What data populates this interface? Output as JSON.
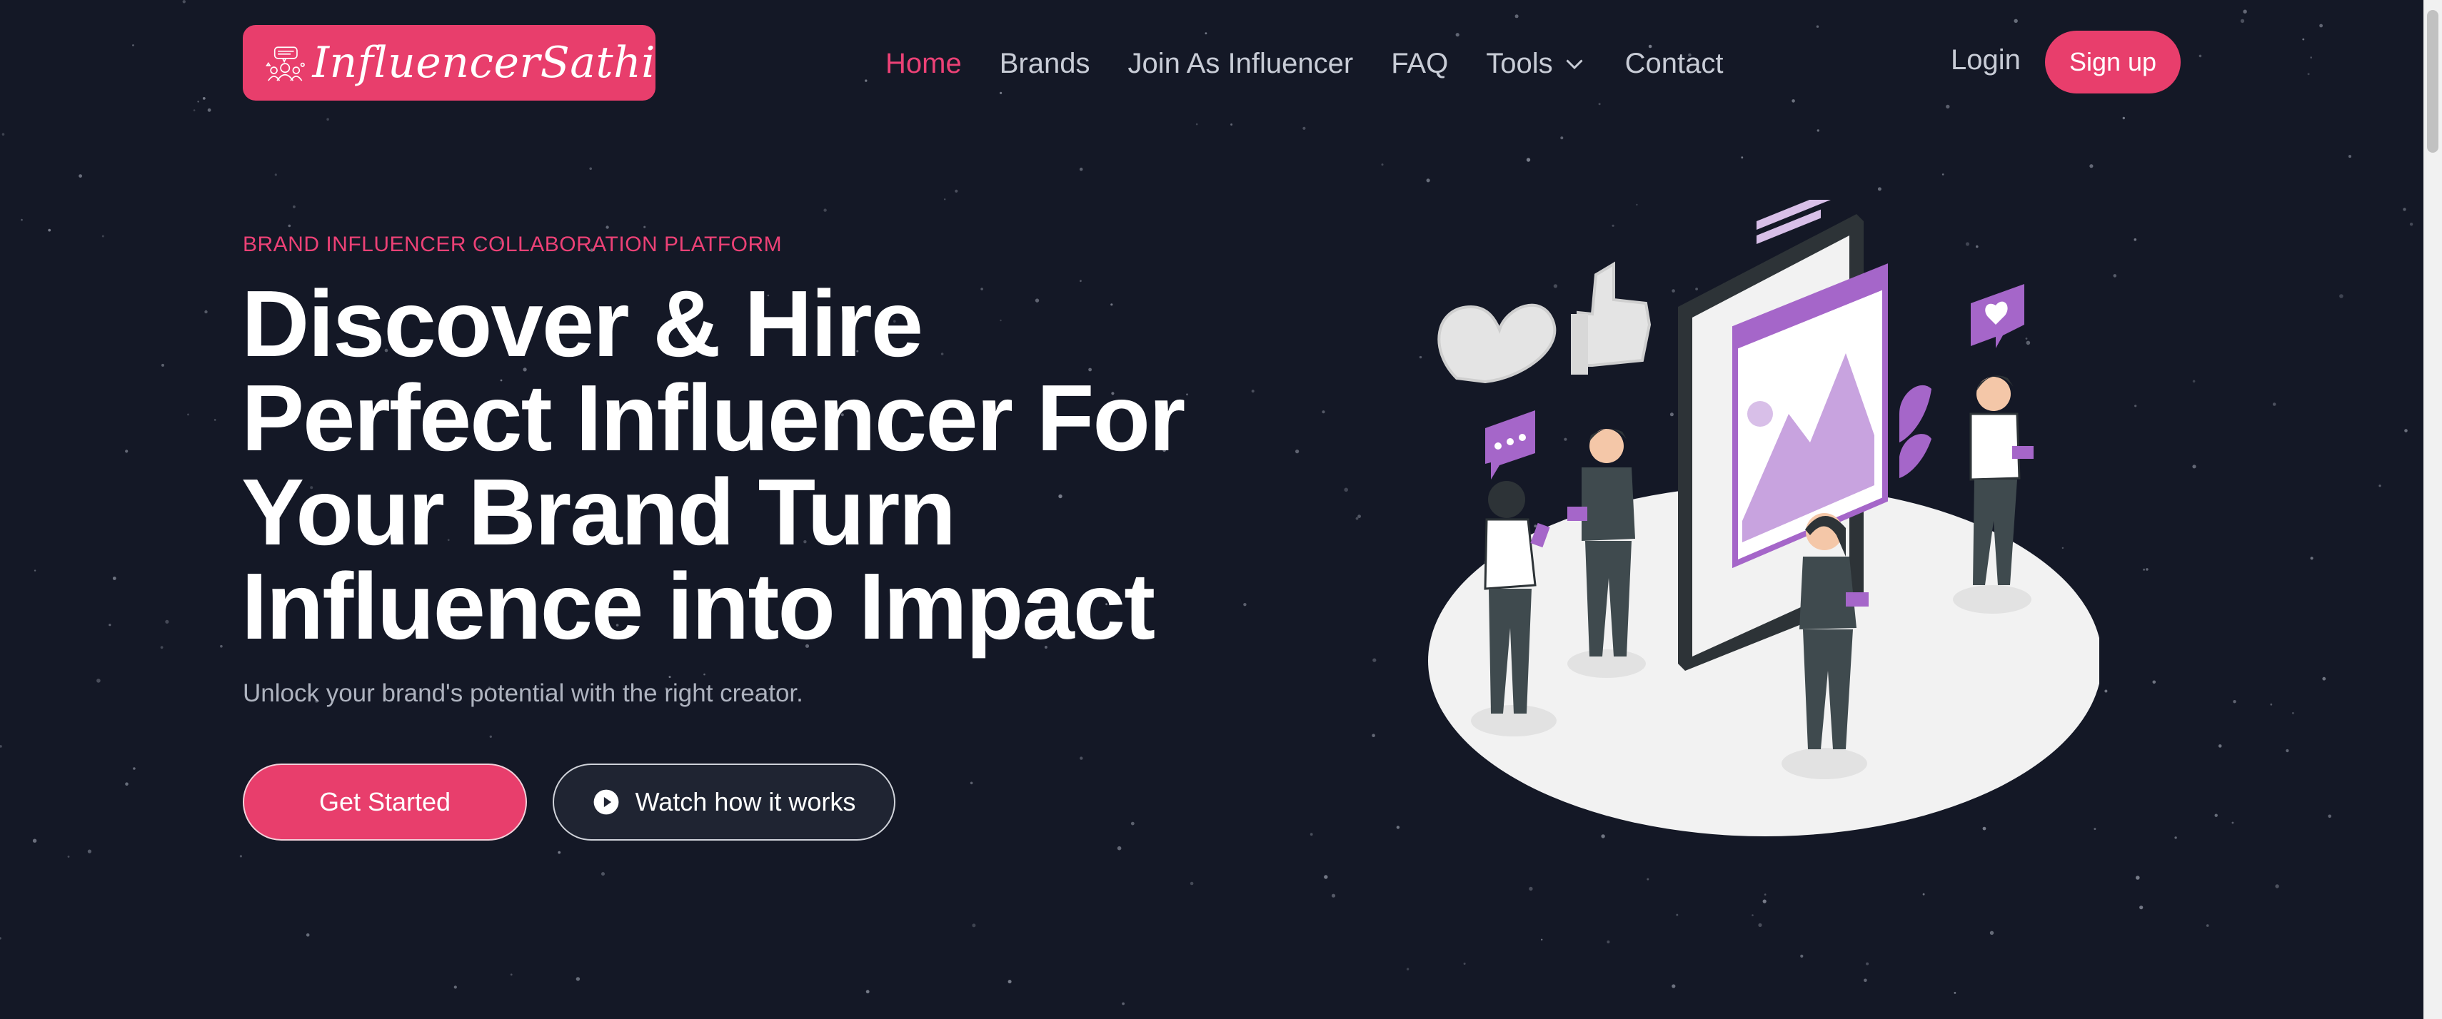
{
  "brand": {
    "name": "InfluencerSathi",
    "color": "#e83e6c"
  },
  "nav": {
    "items": [
      {
        "label": "Home",
        "active": true
      },
      {
        "label": "Brands"
      },
      {
        "label": "Join As Influencer"
      },
      {
        "label": "FAQ"
      },
      {
        "label": "Tools",
        "has_dropdown": true
      },
      {
        "label": "Contact"
      }
    ],
    "login_label": "Login",
    "signup_label": "Sign up"
  },
  "hero": {
    "eyebrow": "BRAND INFLUENCER COLLABORATION PLATFORM",
    "headline_lines": [
      "Discover & Hire",
      "Perfect Influencer For",
      "Your Brand Turn",
      "Influence into Impact"
    ],
    "subtitle": "Unlock your brand's potential with the right creator.",
    "primary_cta": "Get Started",
    "secondary_cta": "Watch how it works"
  },
  "colors": {
    "background": "#141826",
    "accent": "#e83e6c",
    "accent_text": "#ec4176",
    "illustration_purple": "#a566c9"
  },
  "icons": {
    "logo_badge": "influencer-badge-icon",
    "dropdown": "chevron-down-icon",
    "play": "play-circle-icon"
  }
}
